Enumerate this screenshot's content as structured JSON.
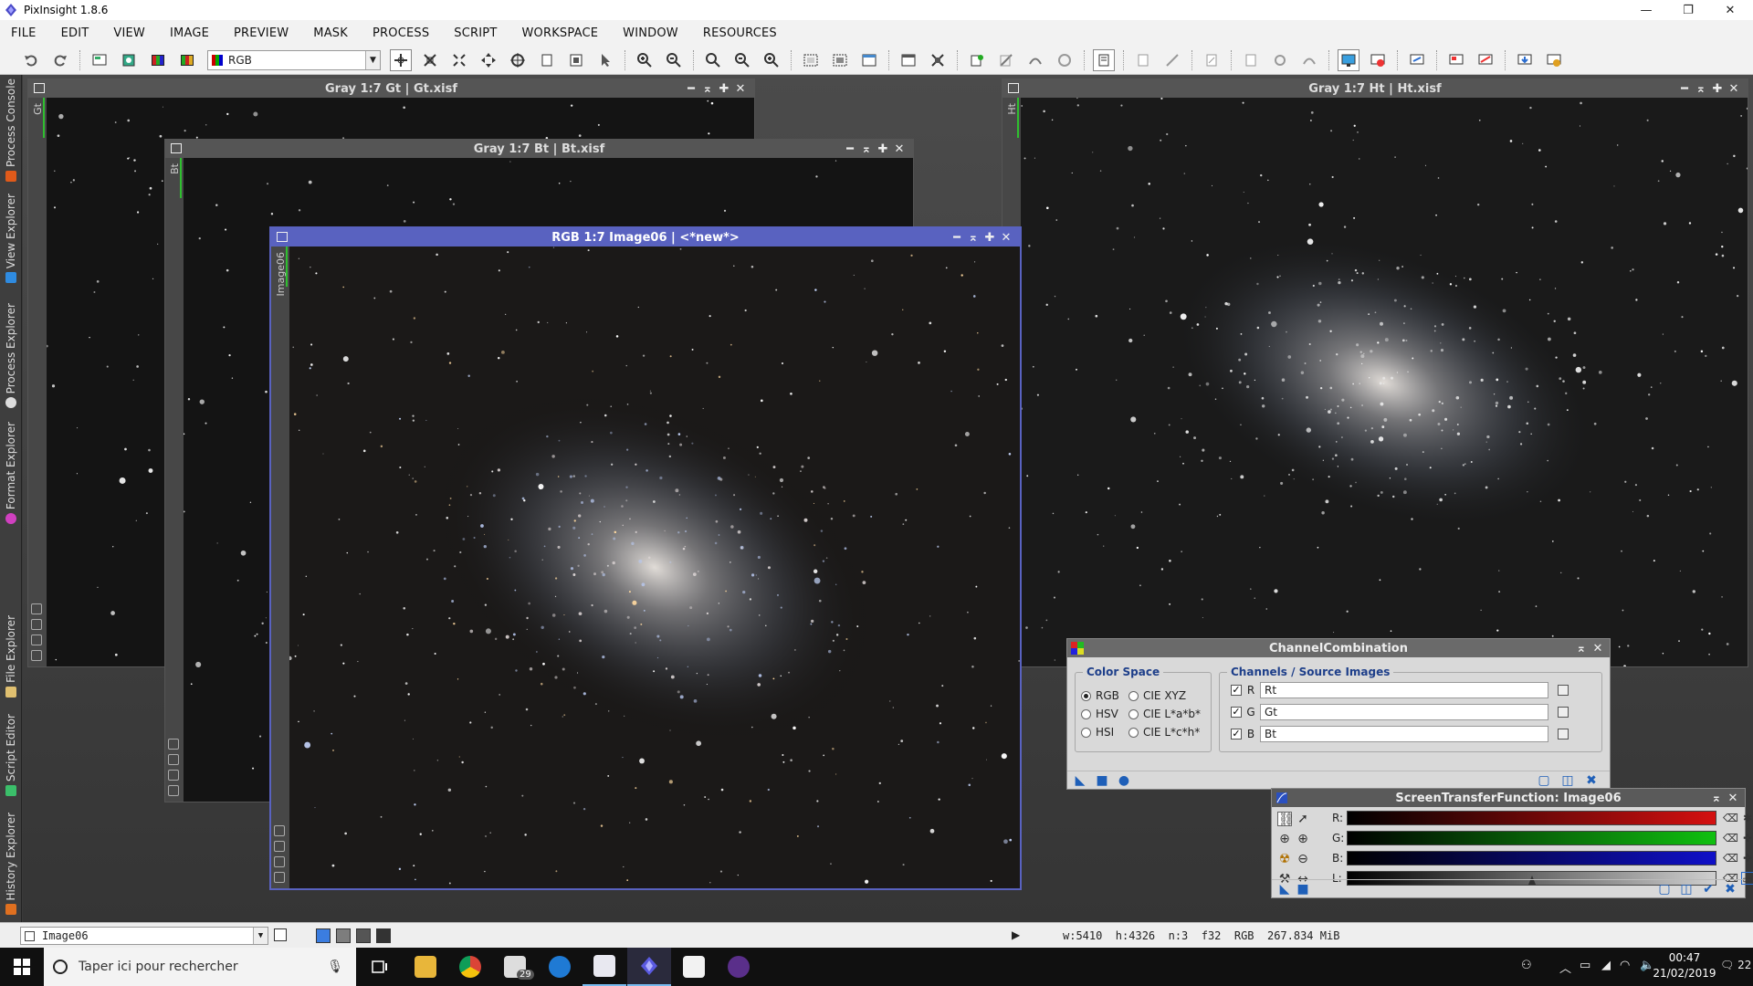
{
  "app": {
    "title": "PixInsight 1.8.6",
    "icon": "pixinsight-logo-icon"
  },
  "window_controls": {
    "minimize": "—",
    "maximize": "❐",
    "close": "✕"
  },
  "menu": [
    "FILE",
    "EDIT",
    "VIEW",
    "IMAGE",
    "PREVIEW",
    "MASK",
    "PROCESS",
    "SCRIPT",
    "WORKSPACE",
    "WINDOW",
    "RESOURCES"
  ],
  "toolbar": {
    "color_mode": "RGB"
  },
  "left_dock": {
    "tabs": [
      {
        "label": "Process Console",
        "icon_color": "#e05a1a"
      },
      {
        "label": "View Explorer",
        "icon_color": "#2f8be0"
      },
      {
        "label": "Process Explorer",
        "icon_color": "#dddddd"
      },
      {
        "label": "Format Explorer",
        "icon_color": "#d040c0"
      },
      {
        "label": "File Explorer",
        "icon_color": "#e0c070"
      },
      {
        "label": "Script Editor",
        "icon_color": "#3bbf6a"
      },
      {
        "label": "History Explorer",
        "icon_color": "#e07020"
      }
    ]
  },
  "windows": {
    "gt": {
      "title": "Gray 1:7 Gt | Gt.xisf",
      "tab": "Gt"
    },
    "bt": {
      "title": "Gray 1:7 Bt | Bt.xisf",
      "tab": "Bt"
    },
    "image06": {
      "title": "RGB 1:7 Image06 | <*new*>",
      "tab": "Image06"
    },
    "ht": {
      "title": "Gray 1:7 Ht | Ht.xisf",
      "tab": "Ht"
    }
  },
  "channel_combination": {
    "title": "ChannelCombination",
    "color_space": {
      "label": "Color Space",
      "options": [
        "RGB",
        "HSV",
        "HSI",
        "CIE XYZ",
        "CIE L*a*b*",
        "CIE L*c*h*"
      ],
      "selected": "RGB"
    },
    "channels": {
      "label": "Channels / Source Images",
      "rows": [
        {
          "channel": "R",
          "checked": true,
          "image": "Rt"
        },
        {
          "channel": "G",
          "checked": true,
          "image": "Gt"
        },
        {
          "channel": "B",
          "checked": true,
          "image": "Bt"
        }
      ]
    }
  },
  "stf": {
    "title": "ScreenTransferFunction: Image06",
    "channels": [
      {
        "label": "R:",
        "color": "#d41010"
      },
      {
        "label": "G:",
        "color": "#10c010"
      },
      {
        "label": "B:",
        "color": "#1010c8"
      },
      {
        "label": "L:",
        "color": "#cfcfcf"
      }
    ],
    "l_midtones": 0.5
  },
  "status": {
    "view": "Image06",
    "info": "w:5410  h:4326  n:3  f32  RGB  267.834 MiB"
  },
  "taskbar": {
    "search_placeholder": "Taper ici pour rechercher",
    "mail_badge": "29",
    "time": "00:47",
    "date": "21/02/2019",
    "notifications": "22"
  }
}
